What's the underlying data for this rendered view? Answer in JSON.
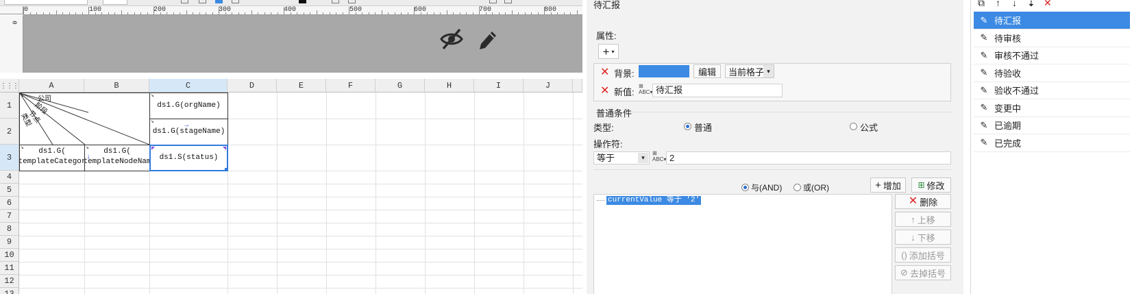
{
  "ruler": {
    "h_labels": [
      "0",
      "100",
      "200",
      "300",
      "400",
      "500",
      "600",
      "700",
      "800"
    ],
    "v_label": "0"
  },
  "grid": {
    "columns": [
      "A",
      "B",
      "C",
      "D",
      "E",
      "F",
      "G",
      "H",
      "I",
      "J"
    ],
    "rows": [
      "1",
      "2",
      "3",
      "4",
      "5",
      "6",
      "7",
      "8",
      "9",
      "10",
      "11",
      "12",
      "13"
    ],
    "cells": {
      "diag_company": "公司",
      "diag_stage": "阶段",
      "diag_node": "节点",
      "diag_type": "类型",
      "c1": "ds1.G(orgName)",
      "c2": "ds1.G(stageName)",
      "a3_line1": "ds1.G(",
      "a3_line2": "templateCategor",
      "b3_line1": "ds1.G(",
      "b3_line2": "templateNodeNam",
      "c3": "ds1.S(status)"
    }
  },
  "panel": {
    "title": "待汇报",
    "attr_section": "属性:",
    "bg_label": "背景:",
    "bg_color": "#3c8ae3",
    "edit_button": "编辑",
    "scope_select": "当前格子",
    "new_value_label": "新值:",
    "new_value": "待汇报",
    "cond_section": "普通条件",
    "type_label": "类型:",
    "type_normal": "普通",
    "type_formula": "公式",
    "operator_label": "操作符:",
    "operator_value": "等于",
    "operand_value": "2",
    "and_label": "与(AND)",
    "or_label": "或(OR)",
    "add_button": "增加",
    "modify_button": "修改",
    "condition_expr": "currentValue 等于 '2'",
    "delete_button": "删除",
    "up_button": "上移",
    "down_button": "下移",
    "add_bracket_button": "添加括号",
    "remove_bracket_button": "去掉括号"
  },
  "status_list": {
    "items": [
      "待汇报",
      "待审核",
      "审核不通过",
      "待验收",
      "验收不通过",
      "变更中",
      "已逾期",
      "已完成"
    ],
    "selected_index": 0
  },
  "colors": {
    "accent": "#3c8ae3",
    "delete_red": "#d22222",
    "selection_blue": "#2f7bdc"
  }
}
